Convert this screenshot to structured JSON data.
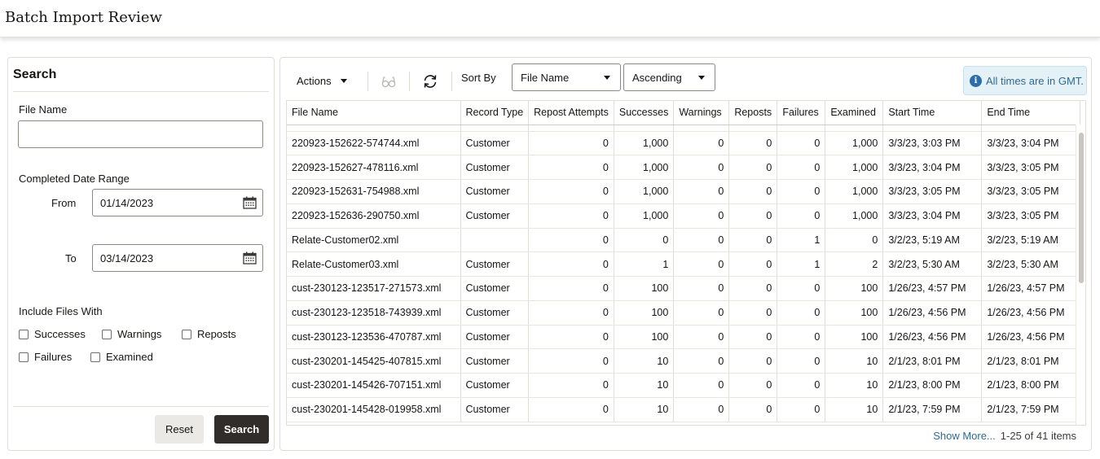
{
  "app": {
    "title": "Batch Import Review"
  },
  "search": {
    "title": "Search",
    "file_name_label": "File Name",
    "file_name_value": "",
    "date_range_label": "Completed Date Range",
    "from_label": "From",
    "from_value": "01/14/2023",
    "to_label": "To",
    "to_value": "03/14/2023",
    "include_label": "Include Files With",
    "checkboxes": [
      {
        "label": "Successes",
        "checked": false
      },
      {
        "label": "Warnings",
        "checked": false
      },
      {
        "label": "Reposts",
        "checked": false
      },
      {
        "label": "Failures",
        "checked": false
      },
      {
        "label": "Examined",
        "checked": false
      }
    ],
    "reset_label": "Reset",
    "search_label": "Search"
  },
  "toolbar": {
    "actions_label": "Actions",
    "sort_by_label": "Sort By",
    "sort_field": "File Name",
    "sort_order": "Ascending",
    "gmt_note": "All times are in GMT."
  },
  "table": {
    "columns": [
      "File Name",
      "Record Type",
      "Repost Attempts",
      "Successes",
      "Warnings",
      "Reposts",
      "Failures",
      "Examined",
      "Start Time",
      "End Time"
    ],
    "rows": [
      [
        "220923-152622-574744.xml",
        "Customer",
        "0",
        "1,000",
        "0",
        "0",
        "0",
        "1,000",
        "3/3/23, 3:03 PM",
        "3/3/23, 3:04 PM"
      ],
      [
        "220923-152627-478116.xml",
        "Customer",
        "0",
        "1,000",
        "0",
        "0",
        "0",
        "1,000",
        "3/3/23, 3:04 PM",
        "3/3/23, 3:05 PM"
      ],
      [
        "220923-152631-754988.xml",
        "Customer",
        "0",
        "1,000",
        "0",
        "0",
        "0",
        "1,000",
        "3/3/23, 3:05 PM",
        "3/3/23, 3:05 PM"
      ],
      [
        "220923-152636-290750.xml",
        "Customer",
        "0",
        "1,000",
        "0",
        "0",
        "0",
        "1,000",
        "3/3/23, 3:04 PM",
        "3/3/23, 3:05 PM"
      ],
      [
        "Relate-Customer02.xml",
        "",
        "0",
        "0",
        "0",
        "0",
        "1",
        "0",
        "3/2/23, 5:19 AM",
        "3/2/23, 5:19 AM"
      ],
      [
        "Relate-Customer03.xml",
        "Customer",
        "0",
        "1",
        "0",
        "0",
        "1",
        "2",
        "3/2/23, 5:30 AM",
        "3/2/23, 5:30 AM"
      ],
      [
        "cust-230123-123517-271573.xml",
        "Customer",
        "0",
        "100",
        "0",
        "0",
        "0",
        "100",
        "1/26/23, 4:57 PM",
        "1/26/23, 4:57 PM"
      ],
      [
        "cust-230123-123518-743939.xml",
        "Customer",
        "0",
        "100",
        "0",
        "0",
        "0",
        "100",
        "1/26/23, 4:56 PM",
        "1/26/23, 4:56 PM"
      ],
      [
        "cust-230123-123536-470787.xml",
        "Customer",
        "0",
        "100",
        "0",
        "0",
        "0",
        "100",
        "1/26/23, 4:56 PM",
        "1/26/23, 4:56 PM"
      ],
      [
        "cust-230201-145425-407815.xml",
        "Customer",
        "0",
        "10",
        "0",
        "0",
        "0",
        "10",
        "2/1/23, 8:01 PM",
        "2/1/23, 8:01 PM"
      ],
      [
        "cust-230201-145426-707151.xml",
        "Customer",
        "0",
        "10",
        "0",
        "0",
        "0",
        "10",
        "2/1/23, 8:00 PM",
        "2/1/23, 8:00 PM"
      ],
      [
        "cust-230201-145428-019958.xml",
        "Customer",
        "0",
        "10",
        "0",
        "0",
        "0",
        "10",
        "2/1/23, 7:59 PM",
        "2/1/23, 7:59 PM"
      ]
    ]
  },
  "footer": {
    "show_more": "Show More...",
    "item_count": "1-25 of 41 items"
  }
}
